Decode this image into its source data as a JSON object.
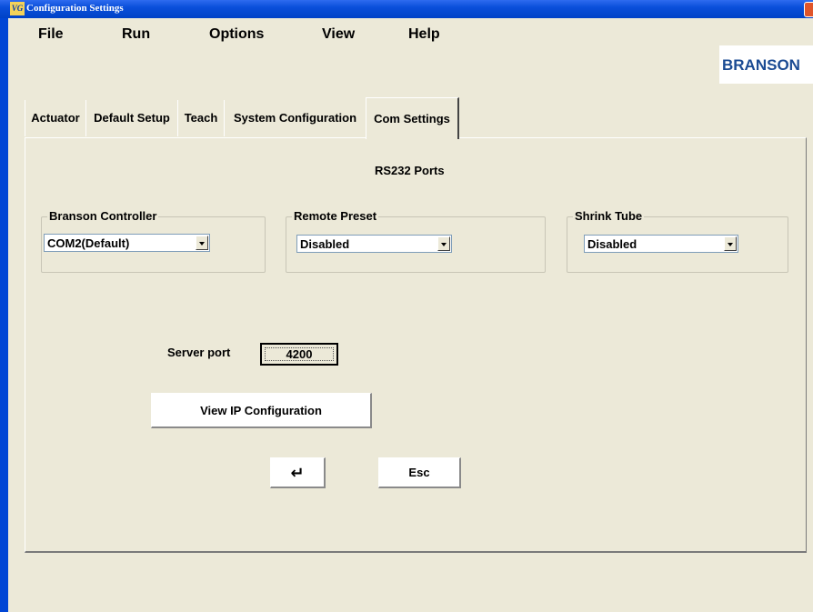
{
  "window": {
    "title": "Configuration Settings",
    "app_icon_text": "VG"
  },
  "menu": {
    "items": [
      "File",
      "Run",
      "Options",
      "View",
      "Help"
    ]
  },
  "brand": {
    "logo_text": "BRANSON",
    "color": "#1B4B93"
  },
  "tabs": [
    "Actuator",
    "Default Setup",
    "Teach",
    "System Configuration",
    "Com Settings"
  ],
  "active_tab": "Com Settings",
  "section": {
    "heading": "RS232 Ports"
  },
  "groups": {
    "branson_controller": {
      "label": "Branson Controller",
      "value": "COM2(Default)"
    },
    "remote_preset": {
      "label": "Remote Preset",
      "value": "Disabled"
    },
    "shrink_tube": {
      "label": "Shrink Tube",
      "value": "Disabled"
    }
  },
  "server": {
    "label": "Server port",
    "value": "4200"
  },
  "buttons": {
    "view_ip": "View IP Configuration",
    "enter": "↵",
    "esc": "Esc"
  },
  "colors": {
    "background": "#ECE9D8",
    "titlebar": "#0A4FDA"
  }
}
